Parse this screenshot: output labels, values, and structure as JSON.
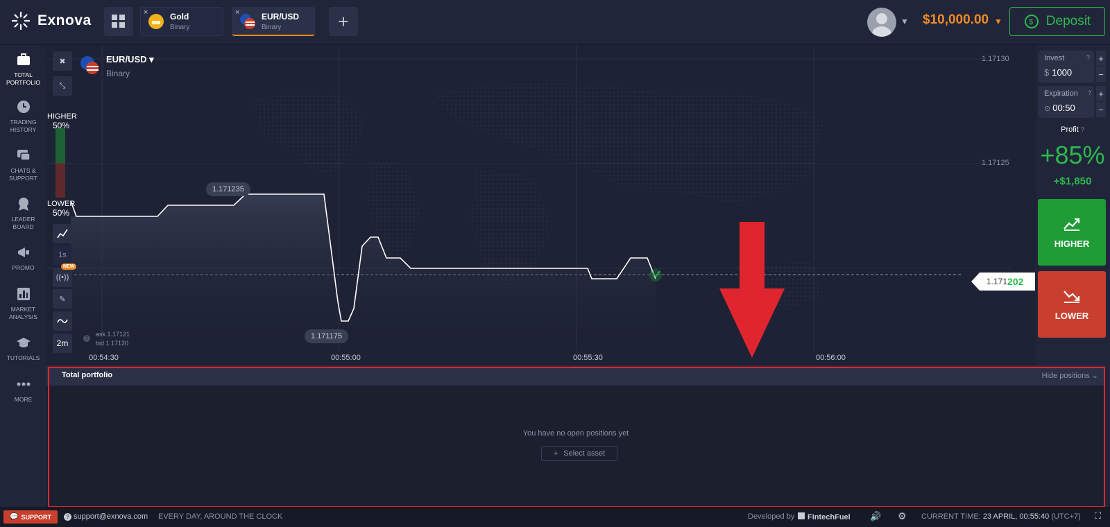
{
  "app": {
    "name": "Exnova"
  },
  "tabs": [
    {
      "name": "Gold",
      "type": "Binary",
      "close": "×"
    },
    {
      "name": "EUR/USD",
      "type": "Binary",
      "close": "×"
    }
  ],
  "header": {
    "balance": "$10,000.00",
    "deposit_label": "Deposit",
    "add_tab": "+"
  },
  "sidebar": {
    "items": [
      {
        "label1": "TOTAL",
        "label2": "PORTFOLIO",
        "icon": "briefcase-icon"
      },
      {
        "label1": "TRADING",
        "label2": "HISTORY",
        "icon": "clock-icon"
      },
      {
        "label1": "CHATS &",
        "label2": "SUPPORT",
        "icon": "chat-icon"
      },
      {
        "label1": "LEADER",
        "label2": "BOARD",
        "icon": "medal-icon"
      },
      {
        "label1": "PROMO",
        "label2": "",
        "icon": "megaphone-icon"
      },
      {
        "label1": "MARKET",
        "label2": "ANALYSIS",
        "icon": "bar-chart-icon"
      },
      {
        "label1": "TUTORIALS",
        "label2": "",
        "icon": "graduation-cap-icon"
      },
      {
        "label1": "MORE",
        "label2": "",
        "icon": "dots-icon"
      }
    ]
  },
  "chart": {
    "asset": "EUR/USD",
    "asset_type": "Binary",
    "higher_label": "HIGHER",
    "higher_pct": "50%",
    "lower_label": "LOWER",
    "lower_pct": "50%",
    "timeframe_1s": "1s",
    "new_badge": "NEW",
    "period": "2m",
    "y_labels": [
      "1.17130",
      "1.17125"
    ],
    "x_labels": [
      "00:54:30",
      "00:55:00",
      "00:55:30",
      "00:56:00"
    ],
    "bubble_high": "1.171235",
    "bubble_low": "1.171175",
    "current_price_prefix": "1.171",
    "current_price_suffix": "202",
    "ask": "ask 1.17121",
    "bid": "bid 1.17120"
  },
  "trade": {
    "invest_label": "Invest",
    "invest_currency": "$",
    "invest_value": "1000",
    "expiration_label": "Expiration",
    "expiration_value": "00:50",
    "profit_label": "Profit",
    "profit_pct": "+85%",
    "profit_amount": "+$1,850",
    "higher_label": "HIGHER",
    "lower_label": "LOWER"
  },
  "portfolio": {
    "title": "Total portfolio",
    "hide_label": "Hide positions",
    "empty_text": "You have no open positions yet",
    "select_label": "Select asset"
  },
  "footer": {
    "support_label": "SUPPORT",
    "email": "support@exnova.com",
    "hours": "EVERY DAY, AROUND THE CLOCK",
    "developed_by": "Developed by",
    "developer": "FintechFuel",
    "time_label": "CURRENT TIME:",
    "time_value": "23 APRIL, 00:55:40",
    "timezone": "(UTC+7)"
  },
  "colors": {
    "accent_orange": "#f08a24",
    "green": "#2eb84d",
    "red": "#c8402d",
    "highlight_red": "#e1252e"
  }
}
